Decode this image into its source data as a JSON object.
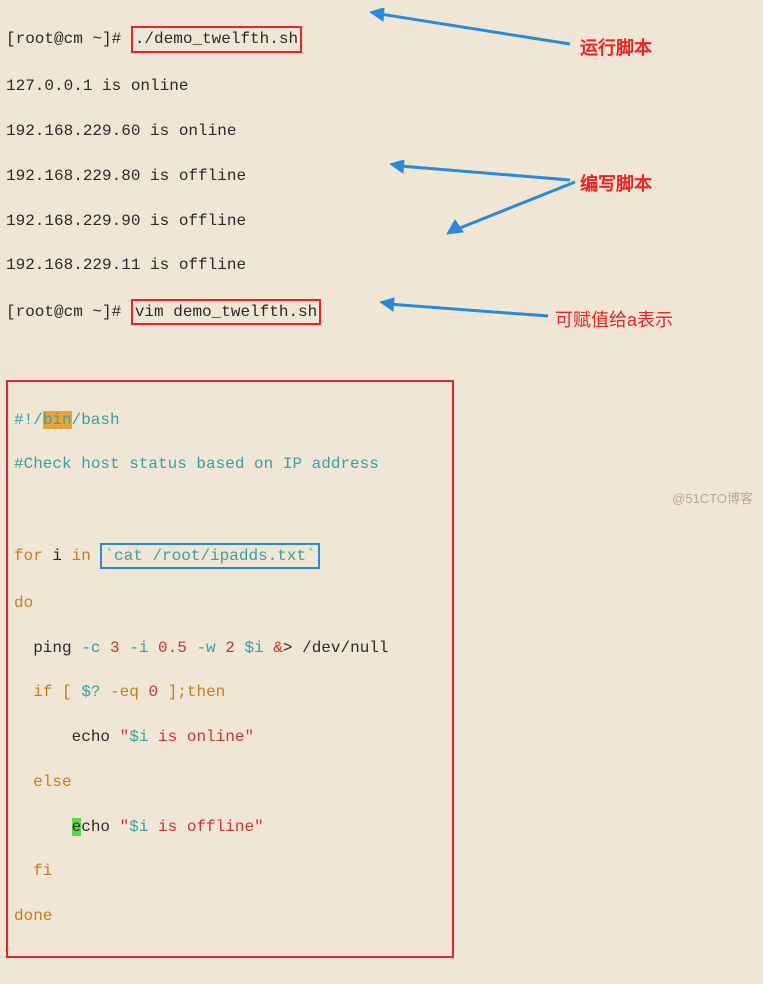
{
  "prompt": "[root@cm ~]# ",
  "cmd1": "./demo_twelfth.sh",
  "out1": "127.0.0.1 is online",
  "out2": "192.168.229.60 is online",
  "out3": "192.168.229.80 is offline",
  "out4": "192.168.229.90 is offline",
  "out5": "192.168.229.11 is offline",
  "cmd2": "vim demo_twelfth.sh",
  "script": {
    "shebang_pre": "#!/",
    "shebang_bin": "bin",
    "shebang_post": "/bash",
    "comment": "#Check host status based on IP address",
    "for": "for",
    "i": " i ",
    "in": "in",
    "cat": "`cat /root/ipadds.txt`",
    "do": "do",
    "ping1": "  ping ",
    "ping_c": "-c",
    "ping_cv": " 3 ",
    "ping_i": "-i",
    "ping_iv": " 0.5 ",
    "ping_w": "-w",
    "ping_wv": " 2 ",
    "ping_var": "$i",
    "ping_amp": " &",
    "ping_gt": ">",
    "ping_dev": " /dev/null",
    "if": "  if ",
    "lb": "[ ",
    "q": "$? ",
    "eq": "-eq",
    "zero": " 0 ",
    "rb": "]",
    "then": ";then",
    "echo1_pre": "      echo ",
    "echo1_q": "\"",
    "echo1_var": "$i",
    "echo1_txt": " is online",
    "else": "  else",
    "echo2_pad": "      ",
    "echo2_e": "e",
    "echo2_cho": "cho ",
    "echo2_var": "$i",
    "echo2_txt": " is offline",
    "fi": "  fi",
    "done": "done"
  },
  "annot1": "运行脚本",
  "annot2": "编写脚本",
  "annot3": "可赋值给a表示",
  "watermark": "@51CTO博客"
}
